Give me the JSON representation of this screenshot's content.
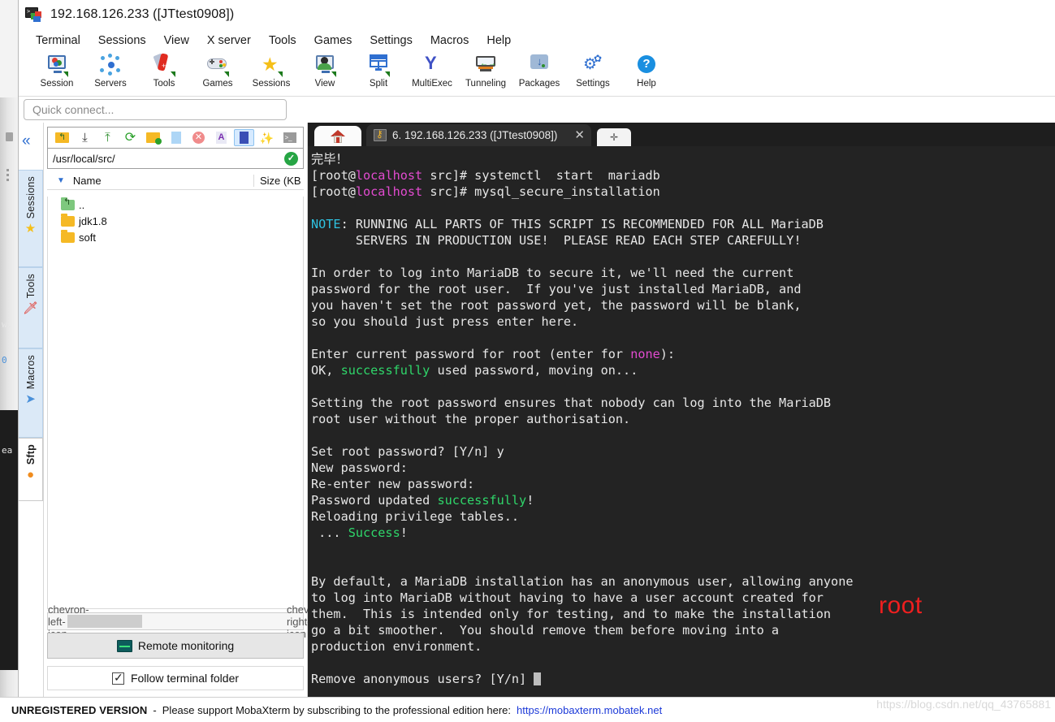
{
  "window": {
    "title": "192.168.126.233 ([JTtest0908])",
    "app_icon": "mobaxterm-icon",
    "prompt_glyph": ">_"
  },
  "menu": {
    "items": [
      {
        "label": "Terminal"
      },
      {
        "label": "Sessions"
      },
      {
        "label": "View"
      },
      {
        "label": "X server"
      },
      {
        "label": "Tools"
      },
      {
        "label": "Games"
      },
      {
        "label": "Settings"
      },
      {
        "label": "Macros"
      },
      {
        "label": "Help"
      }
    ]
  },
  "toolbar": {
    "items": [
      {
        "label": "Session",
        "icon": "session-monitor-icon"
      },
      {
        "label": "Servers",
        "icon": "servers-network-icon"
      },
      {
        "label": "Tools",
        "icon": "tools-knife-icon"
      },
      {
        "label": "Games",
        "icon": "games-gamepad-icon"
      },
      {
        "label": "Sessions",
        "icon": "sessions-star-icon"
      },
      {
        "label": "View",
        "icon": "view-person-icon"
      },
      {
        "label": "Split",
        "icon": "split-panes-icon"
      },
      {
        "label": "MultiExec",
        "icon": "multiexec-fork-icon"
      },
      {
        "label": "Tunneling",
        "icon": "tunneling-arrows-icon"
      },
      {
        "label": "Packages",
        "icon": "packages-download-icon"
      },
      {
        "label": "Settings",
        "icon": "settings-gear-icon"
      },
      {
        "label": "Help",
        "icon": "help-question-icon"
      }
    ]
  },
  "quick_connect": {
    "placeholder": "Quick connect..."
  },
  "side_tabs": {
    "items": [
      {
        "label": "Sessions",
        "icon": "star-icon",
        "selected": false
      },
      {
        "label": "Tools",
        "icon": "knife-icon",
        "selected": false
      },
      {
        "label": "Macros",
        "icon": "paper-plane-icon",
        "selected": false
      },
      {
        "label": "Sftp",
        "icon": "globe-icon",
        "selected": true
      }
    ],
    "collapse_icon": "chevron-double-left-icon"
  },
  "sftp": {
    "toolbar_buttons": [
      {
        "icon": "folder-up-icon",
        "active": false
      },
      {
        "icon": "download-icon",
        "active": false
      },
      {
        "icon": "upload-icon",
        "active": false
      },
      {
        "icon": "refresh-icon",
        "active": false
      },
      {
        "icon": "new-folder-icon",
        "active": false
      },
      {
        "icon": "new-file-icon",
        "active": false
      },
      {
        "icon": "delete-icon",
        "active": false
      },
      {
        "icon": "text-mode-icon",
        "active": false
      },
      {
        "icon": "binary-mode-icon",
        "active": true
      },
      {
        "icon": "magic-wand-icon",
        "active": false
      },
      {
        "icon": "terminal-icon",
        "active": false
      }
    ],
    "path": "/usr/local/src/",
    "path_status_icon": "check-circle-icon",
    "columns": {
      "name": "Name",
      "size": "Size (KB",
      "sort_indicator": "▼"
    },
    "files": [
      {
        "name": "..",
        "type": "parent"
      },
      {
        "name": "jdk1.8",
        "type": "folder"
      },
      {
        "name": "soft",
        "type": "folder"
      }
    ],
    "remote_monitoring_label": "Remote monitoring",
    "remote_monitoring_icon": "monitor-graph-icon",
    "follow_terminal_folder_label": "Follow terminal folder",
    "follow_terminal_folder_checked": true,
    "scroll_left_icon": "chevron-left-icon",
    "scroll_right_icon": "chevron-right-icon"
  },
  "tabs": {
    "home_icon": "home-icon",
    "session_tab": {
      "icon": "key-icon",
      "label": "6. 192.168.126.233 ([JTtest0908])",
      "close_icon": "close-icon"
    },
    "new_tab_icon": "plus-icon"
  },
  "terminal": {
    "background": "#232323",
    "foreground": "#e6e6e6",
    "colors": {
      "magenta": "#e24bd0",
      "cyan": "#2fc2e0",
      "green": "#2fd66a",
      "annotation_red": "#ef1f1f"
    },
    "annotation": "root",
    "lines": [
      {
        "segs": [
          {
            "t": "完毕！"
          }
        ]
      },
      {
        "segs": [
          {
            "t": "[root@"
          },
          {
            "t": "localhost",
            "c": "c-mag"
          },
          {
            "t": " src]# systemctl  start  mariadb"
          }
        ]
      },
      {
        "segs": [
          {
            "t": "[root@"
          },
          {
            "t": "localhost",
            "c": "c-mag"
          },
          {
            "t": " src]# mysql_secure_installation"
          }
        ]
      },
      {
        "segs": [
          {
            "t": ""
          }
        ]
      },
      {
        "segs": [
          {
            "t": "NOTE",
            "c": "c-cyan"
          },
          {
            "t": ": RUNNING ALL PARTS OF THIS SCRIPT IS RECOMMENDED FOR ALL MariaDB"
          }
        ]
      },
      {
        "segs": [
          {
            "t": "      SERVERS IN PRODUCTION USE!  PLEASE READ EACH STEP CAREFULLY!"
          }
        ]
      },
      {
        "segs": [
          {
            "t": ""
          }
        ]
      },
      {
        "segs": [
          {
            "t": "In order to log into MariaDB to secure it, we'll need the current"
          }
        ]
      },
      {
        "segs": [
          {
            "t": "password for the root user.  If you've just installed MariaDB, and"
          }
        ]
      },
      {
        "segs": [
          {
            "t": "you haven't set the root password yet, the password will be blank,"
          }
        ]
      },
      {
        "segs": [
          {
            "t": "so you should just press enter here."
          }
        ]
      },
      {
        "segs": [
          {
            "t": ""
          }
        ]
      },
      {
        "segs": [
          {
            "t": "Enter current password for root (enter for "
          },
          {
            "t": "none",
            "c": "c-mag"
          },
          {
            "t": "):"
          }
        ]
      },
      {
        "segs": [
          {
            "t": "OK, "
          },
          {
            "t": "successfully",
            "c": "c-grn"
          },
          {
            "t": " used password, moving on..."
          }
        ]
      },
      {
        "segs": [
          {
            "t": ""
          }
        ]
      },
      {
        "segs": [
          {
            "t": "Setting the root password ensures that nobody can log into the MariaDB"
          }
        ]
      },
      {
        "segs": [
          {
            "t": "root user without the proper authorisation."
          }
        ]
      },
      {
        "segs": [
          {
            "t": ""
          }
        ]
      },
      {
        "segs": [
          {
            "t": "Set root password? [Y/n] y"
          }
        ]
      },
      {
        "segs": [
          {
            "t": "New password:"
          }
        ]
      },
      {
        "segs": [
          {
            "t": "Re-enter new password:"
          }
        ]
      },
      {
        "segs": [
          {
            "t": "Password updated "
          },
          {
            "t": "successfully",
            "c": "c-grn"
          },
          {
            "t": "!"
          }
        ]
      },
      {
        "segs": [
          {
            "t": "Reloading privilege tables.."
          }
        ]
      },
      {
        "segs": [
          {
            "t": " ... "
          },
          {
            "t": "Success",
            "c": "c-grn"
          },
          {
            "t": "!"
          }
        ]
      },
      {
        "segs": [
          {
            "t": ""
          }
        ]
      },
      {
        "segs": [
          {
            "t": ""
          }
        ]
      },
      {
        "segs": [
          {
            "t": "By default, a MariaDB installation has an anonymous user, allowing anyone"
          }
        ]
      },
      {
        "segs": [
          {
            "t": "to log into MariaDB without having to have a user account created for"
          }
        ]
      },
      {
        "segs": [
          {
            "t": "them.  This is intended only for testing, and to make the installation"
          }
        ]
      },
      {
        "segs": [
          {
            "t": "go a bit smoother.  You should remove them before moving into a"
          }
        ]
      },
      {
        "segs": [
          {
            "t": "production environment."
          }
        ]
      },
      {
        "segs": [
          {
            "t": ""
          }
        ]
      },
      {
        "segs": [
          {
            "t": "Remove anonymous users? [Y/n] "
          },
          {
            "cursor": true
          }
        ]
      }
    ]
  },
  "status_bar": {
    "unregistered": "UNREGISTERED VERSION",
    "separator": "-",
    "message": "Please support MobaXterm by subscribing to the professional edition here:",
    "link": "https://mobaxterm.mobatek.net"
  },
  "watermark": "https://blog.csdn.net/qq_43765881"
}
